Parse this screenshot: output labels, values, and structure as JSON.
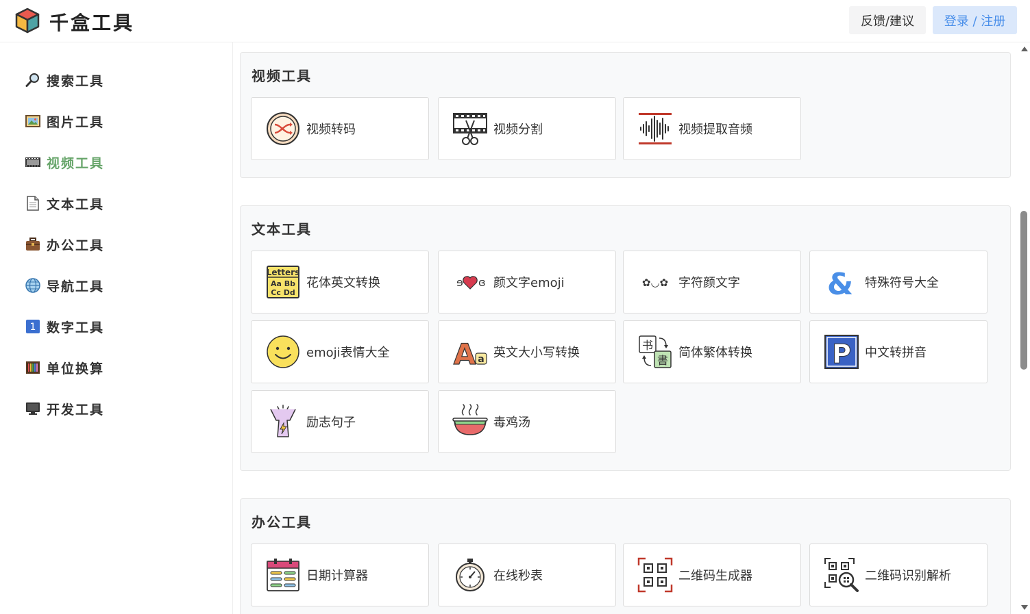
{
  "app": {
    "title": "千盒工具",
    "feedback_label": "反馈/建议",
    "login_label": "登录 / 注册"
  },
  "sidebar": {
    "items": [
      {
        "label": "搜索工具",
        "icon": "magnifier-icon"
      },
      {
        "label": "图片工具",
        "icon": "picture-icon"
      },
      {
        "label": "视频工具",
        "icon": "film-icon",
        "active": true
      },
      {
        "label": "文本工具",
        "icon": "document-icon"
      },
      {
        "label": "办公工具",
        "icon": "briefcase-icon"
      },
      {
        "label": "导航工具",
        "icon": "globe-icon"
      },
      {
        "label": "数字工具",
        "icon": "number-one-icon"
      },
      {
        "label": "单位换算",
        "icon": "abacus-icon"
      },
      {
        "label": "开发工具",
        "icon": "monitor-icon"
      }
    ],
    "active_color": "#67a56a"
  },
  "sections": [
    {
      "title": "视频工具",
      "tools": [
        {
          "label": "视频转码",
          "icon": "shuffle-icon"
        },
        {
          "label": "视频分割",
          "icon": "film-scissors-icon"
        },
        {
          "label": "视频提取音频",
          "icon": "audio-wave-icon"
        }
      ]
    },
    {
      "title": "文本工具",
      "tools": [
        {
          "label": "花体英文转换",
          "icon": "letters-icon"
        },
        {
          "label": "颜文字emoji",
          "icon": "kaomoji-heart-icon"
        },
        {
          "label": "字符颜文字",
          "icon": "char-face-icon"
        },
        {
          "label": "特殊符号大全",
          "icon": "ampersand-icon"
        },
        {
          "label": "emoji表情大全",
          "icon": "smiley-icon"
        },
        {
          "label": "英文大小写转换",
          "icon": "case-convert-icon"
        },
        {
          "label": "简体繁体转换",
          "icon": "chinese-convert-icon"
        },
        {
          "label": "中文转拼音",
          "icon": "pinyin-p-icon"
        },
        {
          "label": "励志句子",
          "icon": "cheer-person-icon"
        },
        {
          "label": "毒鸡汤",
          "icon": "soup-bowl-icon"
        }
      ]
    },
    {
      "title": "办公工具",
      "tools": [
        {
          "label": "日期计算器",
          "icon": "calendar-icon"
        },
        {
          "label": "在线秒表",
          "icon": "stopwatch-icon"
        },
        {
          "label": "二维码生成器",
          "icon": "qrcode-icon"
        },
        {
          "label": "二维码识别解析",
          "icon": "qrcode-search-icon"
        }
      ]
    }
  ],
  "icon_texts": {
    "letters_line1": "Letters",
    "letters_line2": "Aa Bb",
    "letters_line3": "Cc Dd",
    "kaomoji_left": "ɘ",
    "kaomoji_right": "ɞ",
    "char_face": "✿◡✿",
    "ampersand": "&",
    "case_big": "A",
    "case_small": "a",
    "simplified_char": "书",
    "traditional_char": "書",
    "pinyin_letter": "P",
    "number_one": "1"
  }
}
